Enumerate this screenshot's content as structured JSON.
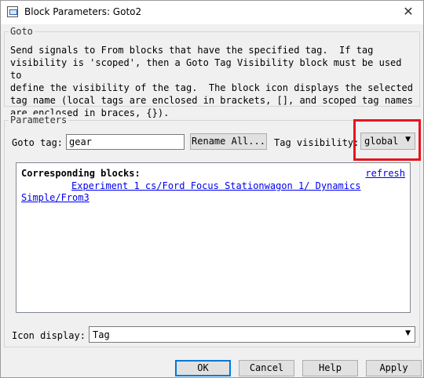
{
  "window": {
    "title": "Block Parameters: Goto2",
    "close_glyph": "✕"
  },
  "goto_group": {
    "title": "Goto",
    "description": "Send signals to From blocks that have the specified tag.  If tag\nvisibility is 'scoped', then a Goto Tag Visibility block must be used to\ndefine the visibility of the tag.  The block icon displays the selected\ntag name (local tags are enclosed in brackets, [], and scoped tag names\nare enclosed in braces, {})."
  },
  "parameters": {
    "title": "Parameters",
    "goto_tag_label": "Goto tag:",
    "goto_tag_value": "gear",
    "rename_all_label": "Rename All...",
    "tag_visibility_label": "Tag visibility:",
    "tag_visibility_value": "global",
    "highlight_color": "#e8141d"
  },
  "corresponding_blocks": {
    "heading": "Corresponding blocks:",
    "refresh_label": "refresh",
    "link_text": "Experiment 1 cs/Ford Focus Stationwagon 1/ Dynamics Simple/From3"
  },
  "icon_display": {
    "label": "Icon display:",
    "value": "Tag"
  },
  "footer": {
    "ok_label": "OK",
    "cancel_label": "Cancel",
    "help_label": "Help",
    "apply_label": "Apply"
  }
}
